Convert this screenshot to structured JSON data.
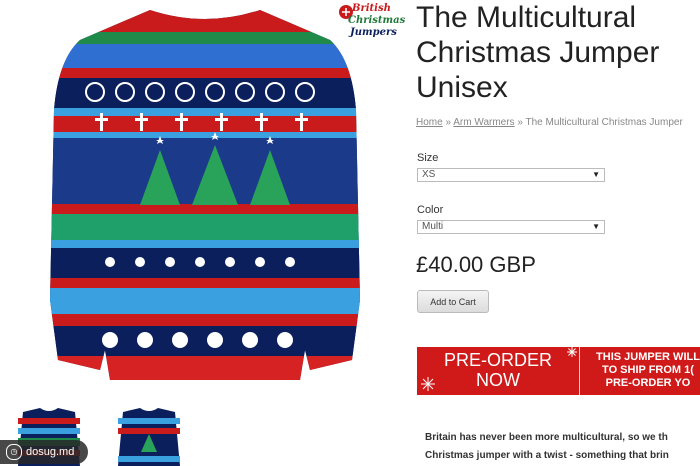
{
  "logo": {
    "lines": [
      "British",
      "Christmas",
      "Jumpers"
    ]
  },
  "product": {
    "title_lines": [
      "The Multicultural",
      "Christmas Jumper",
      "Unisex"
    ],
    "breadcrumb": {
      "home": "Home",
      "category": "Arm Warmers",
      "sep": "»",
      "current": "The Multicultural Christmas Jumper"
    },
    "size_label": "Size",
    "size_value": "XS",
    "color_label": "Color",
    "color_value": "Multi",
    "price": "£40.00 GBP",
    "add_to_cart": "Add to Cart"
  },
  "preorder": {
    "button_lines": [
      "PRE-ORDER",
      "NOW"
    ],
    "note_lines": [
      "THIS JUMPER WILL",
      "TO SHIP FROM 1(",
      "PRE-ORDER YO"
    ]
  },
  "description": {
    "lines": [
      "Britain has never been more multicultural, so we th",
      "Christmas jumper with a twist - something that brin"
    ]
  },
  "watermark": {
    "icon": "clock-icon",
    "text": "dosug.md"
  },
  "colors": {
    "red": "#d01a1a",
    "navy": "#0b1f5c",
    "green": "#1f8a4a",
    "sky": "#3aa0e0"
  }
}
